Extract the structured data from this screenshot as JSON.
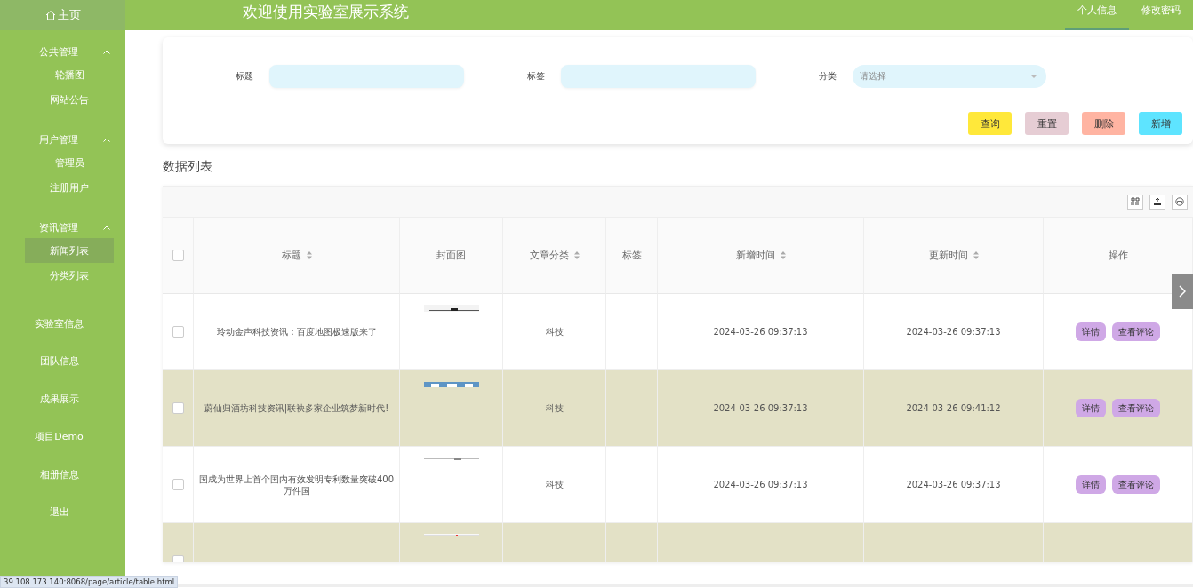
{
  "header": {
    "home": {
      "label": "主页"
    },
    "title": "欢迎使用实验室展示系统",
    "nav": [
      {
        "label": "个人信息",
        "selected": true
      },
      {
        "label": "修改密码",
        "selected": false
      }
    ]
  },
  "sidebar": {
    "menu": [
      {
        "kind": "group",
        "label": "公共管理",
        "expanded": true,
        "children": [
          {
            "label": "轮播图",
            "selected": false
          },
          {
            "label": "网站公告",
            "selected": false
          }
        ]
      },
      {
        "kind": "group",
        "label": "用户管理",
        "expanded": true,
        "children": [
          {
            "label": "管理员",
            "selected": false
          },
          {
            "label": "注册用户",
            "selected": false
          }
        ]
      },
      {
        "kind": "group",
        "label": "资讯管理",
        "expanded": true,
        "children": [
          {
            "label": "新闻列表",
            "selected": true
          },
          {
            "label": "分类列表",
            "selected": false
          }
        ]
      },
      {
        "kind": "link",
        "label": "实验室信息",
        "selected": false
      },
      {
        "kind": "link",
        "label": "团队信息",
        "selected": false
      },
      {
        "kind": "link",
        "label": "成果展示",
        "selected": false
      },
      {
        "kind": "link",
        "label": "项目Demo",
        "selected": false
      },
      {
        "kind": "link",
        "label": "相册信息",
        "selected": false
      },
      {
        "kind": "link",
        "label": "退出",
        "selected": false
      }
    ]
  },
  "search": {
    "fields": [
      {
        "kind": "text",
        "label": "标题"
      },
      {
        "kind": "text",
        "label": "标签"
      },
      {
        "kind": "select",
        "label": "分类",
        "placeholder": "请选择"
      }
    ],
    "buttons": [
      {
        "label": "查询",
        "color": "#ffe83a"
      },
      {
        "label": "重置",
        "color": "#e6cdd4"
      },
      {
        "label": "删除",
        "color": "#ffb4a2"
      },
      {
        "label": "新增",
        "color": "#5ee4ff"
      }
    ]
  },
  "list_title": "数据列表",
  "table": {
    "columns": [
      {
        "kind": "checkbox",
        "checked": false
      },
      {
        "kind": "text",
        "label": "标题",
        "sortable": true
      },
      {
        "kind": "text",
        "label": "封面图",
        "sortable": false
      },
      {
        "kind": "text",
        "label": "文章分类",
        "sortable": true
      },
      {
        "kind": "text",
        "label": "标签",
        "sortable": false
      },
      {
        "kind": "text",
        "label": "新增时间",
        "sortable": true
      },
      {
        "kind": "text",
        "label": "更新时间",
        "sortable": true
      },
      {
        "kind": "text",
        "label": "操作",
        "sortable": false
      }
    ],
    "rows": [
      {
        "checked": false,
        "title": "玲动金声科技资讯：百度地图极速版来了",
        "cover": {
          "kind": "picture"
        },
        "category": "科技",
        "created": "2024-03-26 09:37:13",
        "updated": "2024-03-26 09:37:13",
        "actions": [
          "详情",
          "查看评论"
        ]
      },
      {
        "checked": false,
        "title": "蔚仙归酒坊科技资讯|联袂多家企业筑梦新时代!",
        "cover": {
          "kind": "picture"
        },
        "category": "科技",
        "created": "2024-03-26 09:37:13",
        "updated": "2024-03-26 09:41:12",
        "actions": [
          "详情",
          "查看评论"
        ]
      },
      {
        "checked": false,
        "title": "国成为世界上首个国内有效发明专利数量突破400万件国",
        "cover": {
          "kind": "picture"
        },
        "category": "科技",
        "created": "2024-03-26 09:37:13",
        "updated": "2024-03-26 09:37:13",
        "actions": [
          "详情",
          "查看评论"
        ]
      },
      {
        "checked": false,
        "cover": {
          "kind": "picture"
        }
      }
    ]
  },
  "status_url": "39.108.173.140:8068/page/article/table.html"
}
